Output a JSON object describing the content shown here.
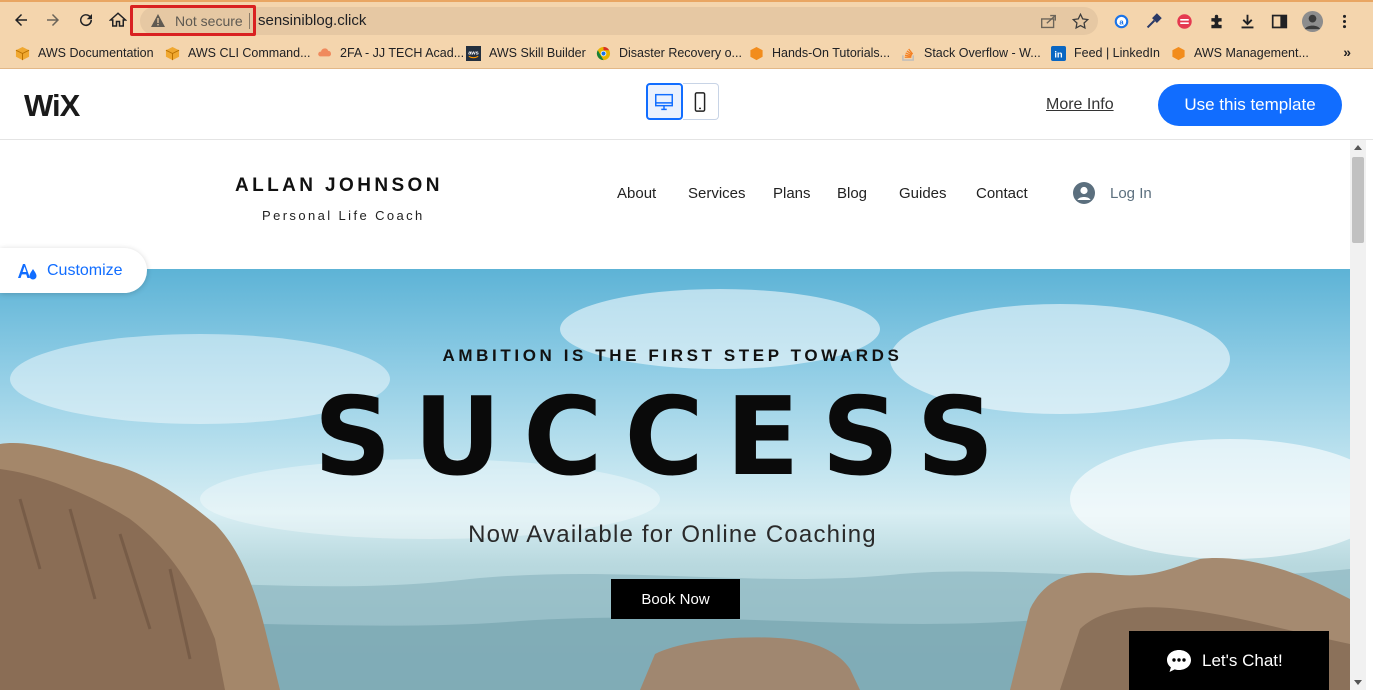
{
  "browser": {
    "security_label": "Not secure",
    "url": "sensiniblog.click",
    "bookmarks": [
      {
        "label": "AWS Documentation"
      },
      {
        "label": "AWS CLI Command..."
      },
      {
        "label": "2FA - JJ TECH Acad..."
      },
      {
        "label": "AWS Skill Builder"
      },
      {
        "label": "Disaster Recovery o..."
      },
      {
        "label": "Hands-On Tutorials..."
      },
      {
        "label": "Stack Overflow - W..."
      },
      {
        "label": "Feed | LinkedIn"
      },
      {
        "label": "AWS Management..."
      }
    ],
    "bookmarks_overflow": "»"
  },
  "wix": {
    "logo": "WiX",
    "more_info": "More Info",
    "use_template": "Use this template"
  },
  "site": {
    "name": "ALLAN JOHNSON",
    "tagline": "Personal Life Coach",
    "nav": [
      "About",
      "Services",
      "Plans",
      "Blog",
      "Guides",
      "Contact"
    ],
    "login": "Log In",
    "hero": {
      "kicker": "AMBITION IS THE FIRST STEP TOWARDS",
      "title": "SUCCESS",
      "subtitle": "Now Available for Online Coaching",
      "cta": "Book Now"
    }
  },
  "overlays": {
    "customize": "Customize",
    "chat": "Let's Chat!"
  },
  "colors": {
    "accent": "#116dff",
    "toolbar": "#f4d5ad",
    "security_highlight": "#d92121"
  }
}
